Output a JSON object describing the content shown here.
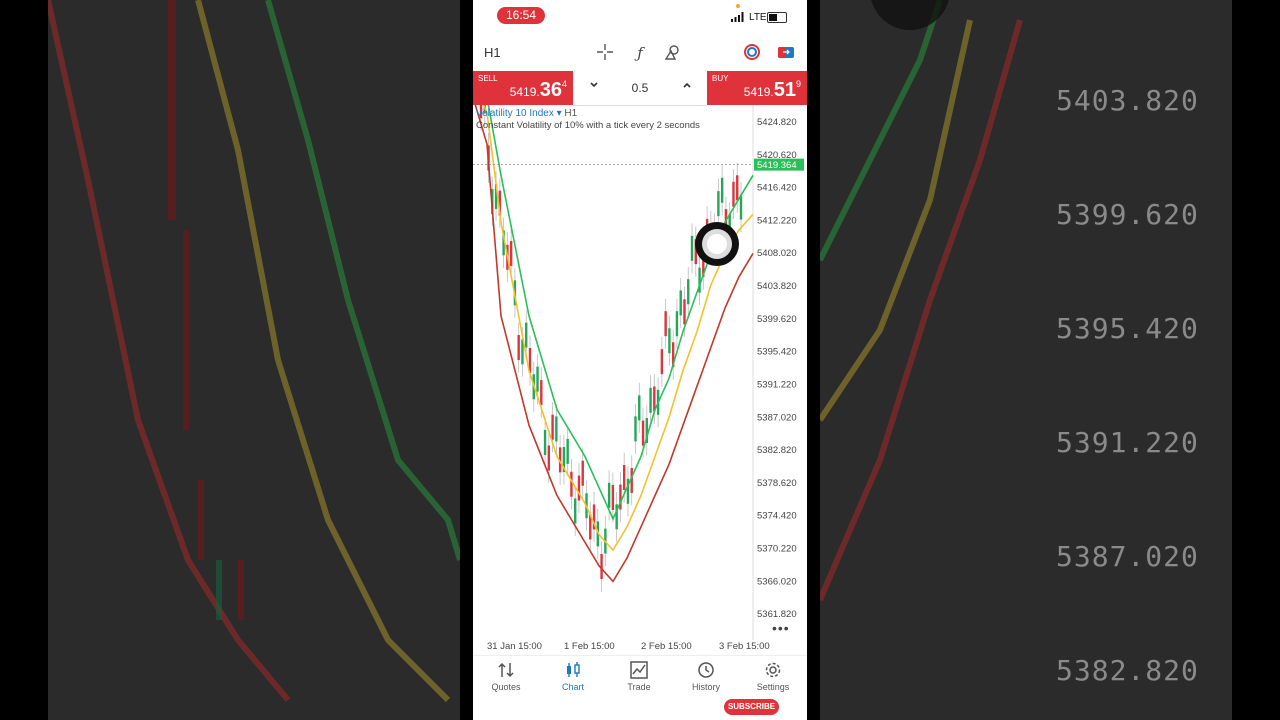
{
  "status_bar": {
    "time": "16:54",
    "network": "LTE"
  },
  "toolbar": {
    "timeframe": "H1"
  },
  "trade": {
    "sell_label": "SELL",
    "sell_price_main": "5419.",
    "sell_price_big": "36",
    "sell_price_sup": "4",
    "buy_label": "BUY",
    "buy_price_main": "5419.",
    "buy_price_big": "51",
    "buy_price_sup": "9",
    "volume": "0.5"
  },
  "chart": {
    "symbol": "Volatility 10 Index",
    "symbol_arrow": "▾",
    "timeframe": "H1",
    "description": "Constant Volatility of 10% with a tick every 2 seconds",
    "current_price": "5419.364",
    "more": "•••",
    "x_labels": [
      "31 Jan 15:00",
      "1 Feb 15:00",
      "2 Feb 15:00",
      "3 Feb 15:00"
    ]
  },
  "chart_data": {
    "type": "line",
    "title": "",
    "y_ticks": [
      5424.82,
      5420.62,
      5416.42,
      5412.22,
      5408.02,
      5403.82,
      5399.62,
      5395.42,
      5391.22,
      5387.02,
      5382.82,
      5378.62,
      5374.42,
      5370.22,
      5366.02,
      5361.82
    ],
    "ylim": [
      5358.5,
      5427.0
    ],
    "current_price": 5419.364,
    "grid": false,
    "series": [
      {
        "color": "#2bbf5a",
        "x": [
          0,
          0.05,
          0.1,
          0.2,
          0.3,
          0.4,
          0.45,
          0.5,
          0.55,
          0.6,
          0.65,
          0.7,
          0.75,
          0.8,
          0.85,
          0.9,
          0.95,
          1.0
        ],
        "values": [
          5430,
          5428,
          5418,
          5400,
          5388,
          5382,
          5378,
          5374,
          5378,
          5382,
          5388,
          5392,
          5398,
          5403,
          5408,
          5412,
          5415,
          5418
        ]
      },
      {
        "color": "#f2c12e",
        "x": [
          0,
          0.05,
          0.1,
          0.2,
          0.3,
          0.4,
          0.45,
          0.5,
          0.55,
          0.6,
          0.65,
          0.7,
          0.75,
          0.8,
          0.85,
          0.9,
          0.95,
          1.0
        ],
        "values": [
          5430,
          5426,
          5412,
          5393,
          5382,
          5376,
          5372,
          5370,
          5373,
          5377,
          5382,
          5387,
          5393,
          5398,
          5404,
          5408,
          5411,
          5413
        ]
      },
      {
        "color": "#c0392b",
        "x": [
          0,
          0.05,
          0.1,
          0.2,
          0.3,
          0.4,
          0.45,
          0.5,
          0.55,
          0.6,
          0.65,
          0.7,
          0.75,
          0.8,
          0.85,
          0.9,
          0.95,
          1.0
        ],
        "values": [
          5428,
          5422,
          5400,
          5386,
          5377,
          5371,
          5368,
          5366,
          5369,
          5373,
          5377,
          5381,
          5386,
          5391,
          5396,
          5401,
          5405,
          5408
        ]
      }
    ]
  },
  "tabs": [
    {
      "label": "Quotes",
      "icon": "quotes-icon"
    },
    {
      "label": "Chart",
      "icon": "chart-icon",
      "active": true
    },
    {
      "label": "Trade",
      "icon": "trade-icon"
    },
    {
      "label": "History",
      "icon": "history-icon"
    },
    {
      "label": "Settings",
      "icon": "settings-icon"
    }
  ],
  "overlay": {
    "subscribe": "SUBSCRIBE"
  },
  "background_right": {
    "prices": [
      "5403.820",
      "5399.620",
      "5395.420",
      "5391.220",
      "5387.020",
      "5382.820"
    ]
  },
  "colors": {
    "accent_red": "#e0323a",
    "accent_blue": "#1f77c7",
    "current_price_bg": "#2bbf5a"
  }
}
